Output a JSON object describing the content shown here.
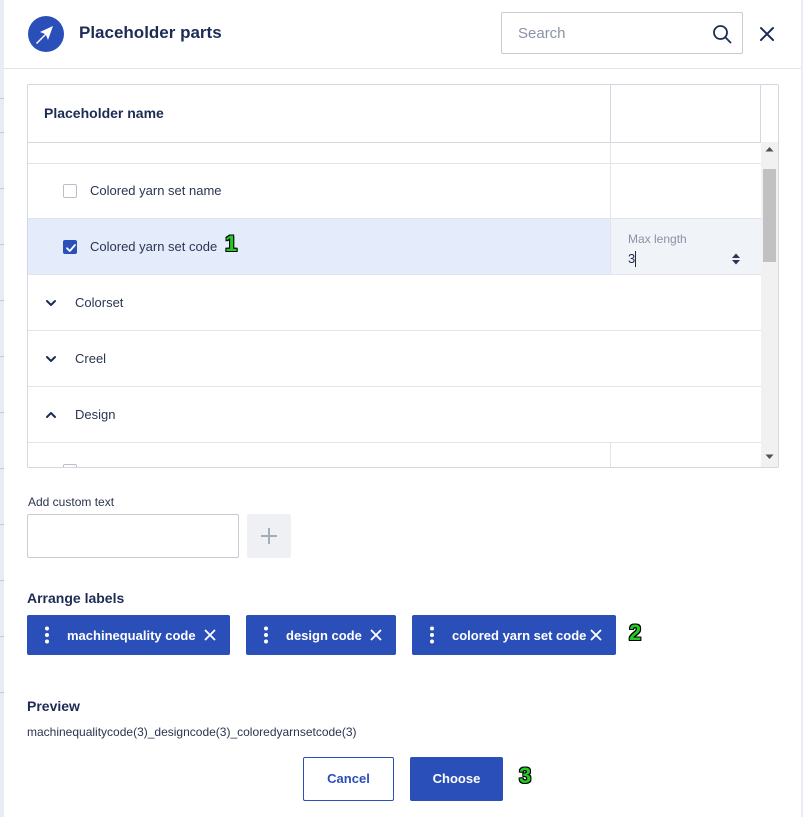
{
  "dialog": {
    "title": "Placeholder parts",
    "search_placeholder": "Search"
  },
  "table": {
    "header_name": "Placeholder name",
    "rows": [
      {
        "type": "item",
        "label": "Colored yarn set name",
        "checked": false
      },
      {
        "type": "item",
        "label": "Colored yarn set code",
        "checked": true,
        "max_length_label": "Max length",
        "max_length_value": "3"
      },
      {
        "type": "group",
        "label": "Colorset",
        "expanded": false
      },
      {
        "type": "group",
        "label": "Creel",
        "expanded": false
      },
      {
        "type": "group",
        "label": "Design",
        "expanded": true
      }
    ]
  },
  "custom_text": {
    "label": "Add custom text",
    "value": ""
  },
  "arrange": {
    "title": "Arrange labels",
    "chips": [
      {
        "label": "machinequality code"
      },
      {
        "label": "design code"
      },
      {
        "label": "colored yarn set code"
      }
    ]
  },
  "preview": {
    "title": "Preview",
    "text": "machinequalitycode(3)_designcode(3)_coloredyarnsetcode(3)"
  },
  "buttons": {
    "cancel": "Cancel",
    "choose": "Choose"
  },
  "annotations": {
    "one": "1",
    "two": "2",
    "three": "3"
  },
  "colors": {
    "accent": "#2b4fb8",
    "selected_row": "#e4ecfb",
    "annotation": "#22cc22"
  }
}
